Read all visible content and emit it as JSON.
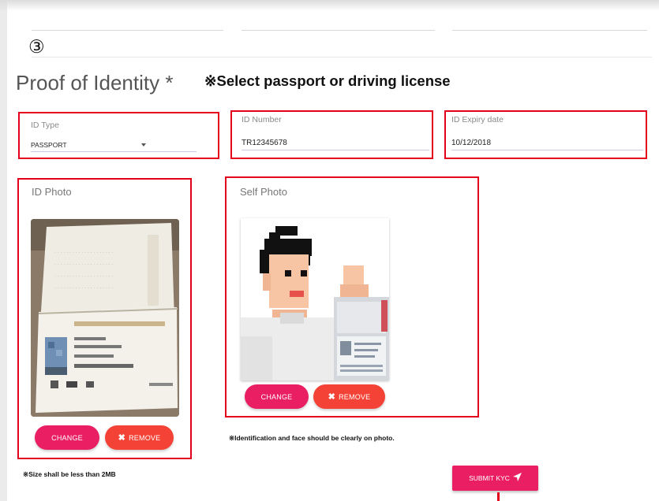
{
  "step": "③",
  "section": {
    "title": "Proof of Identity *",
    "note": "※Select passport or driving license"
  },
  "fields": {
    "id_type": {
      "label": "ID Type",
      "value": "PASSPORT"
    },
    "id_number": {
      "label": "ID Number",
      "value": "TR12345678"
    },
    "id_expiry": {
      "label": "ID Expiry date",
      "value": "10/12/2018"
    }
  },
  "id_photo": {
    "label": "ID Photo",
    "change_label": "CHANGE",
    "remove_label": "REMOVE",
    "note": "※Size shall be less than 2MB"
  },
  "self_photo": {
    "label": "Self Photo",
    "change_label": "CHANGE",
    "remove_label": "REMOVE",
    "note": "※Identification and face should be clearly on photo."
  },
  "submit_label": "SUBMIT KYC",
  "icons": {
    "dropdown": "caret-down-icon",
    "remove": "close-icon",
    "submit": "send-icon"
  },
  "colors": {
    "primary": "#e91e63",
    "remove": "#f44336",
    "highlight": "#e2001a"
  }
}
